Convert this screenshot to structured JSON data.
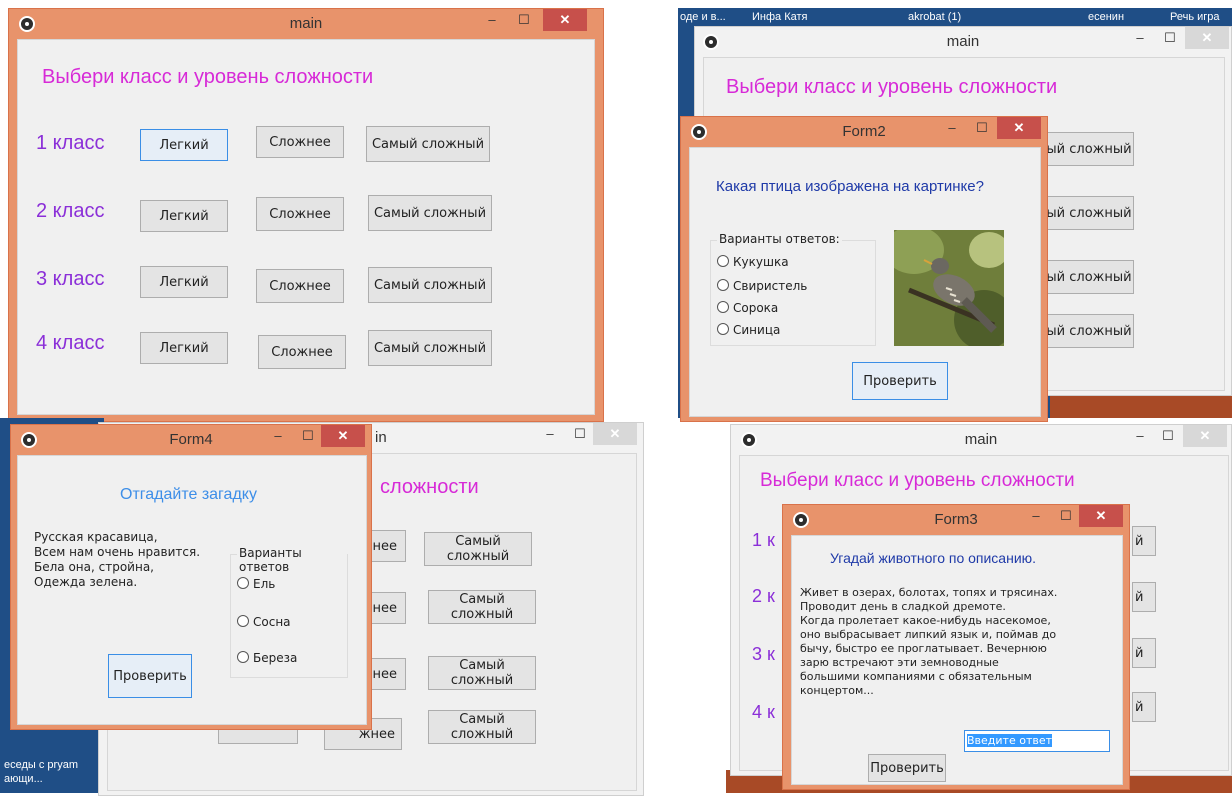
{
  "colors": {
    "frame_active": "#e8936b",
    "heading": "#d72ad7",
    "grade": "#8b2fd8",
    "question": "#1f3aa8",
    "riddle": "#3d8ee8"
  },
  "controls": {
    "minimize": "–",
    "maximize": "☐",
    "close": "✕"
  },
  "main": {
    "title": "main",
    "heading": "Выбери класс и уровень сложности",
    "rows": [
      {
        "grade": "1 класс",
        "easy": "Легкий",
        "harder": "Сложнее",
        "hardest": "Самый сложный"
      },
      {
        "grade": "2 класс",
        "easy": "Легкий",
        "harder": "Сложнее",
        "hardest": "Самый сложный"
      },
      {
        "grade": "3 класс",
        "easy": "Легкий",
        "harder": "Сложнее",
        "hardest": "Самый сложный"
      },
      {
        "grade": "4 класс",
        "easy": "Легкий",
        "harder": "Сложнее",
        "hardest": "Самый сложный"
      }
    ]
  },
  "desktop_tr": {
    "items": [
      "оде и в...",
      "Инфа Катя",
      "akrobat (1)",
      "есенин",
      "Речь игра"
    ]
  },
  "main_tr": {
    "title": "main",
    "heading": "Выбери класс и уровень сложности",
    "partial_buttons": [
      "ый сложный",
      "ый сложный",
      "ый сложный",
      "ый сложный"
    ]
  },
  "form2": {
    "title": "Form2",
    "question": "Какая птица изображена на картинке?",
    "group_label": "Варианты ответов:",
    "options": [
      "Кукушка",
      "Свиристель",
      "Сорока",
      "Синица"
    ],
    "check": "Проверить"
  },
  "main_bl": {
    "title_partial": "in",
    "heading_partial": "сложности",
    "partial_harder": [
      "нее",
      "нее",
      "нее",
      "жнее"
    ],
    "hardest": [
      "Самый сложный",
      "Самый сложный",
      "Самый сложный",
      "Самый сложный"
    ]
  },
  "desktop_bl": {
    "line1": "еседы с pryam",
    "line2": "ающи..."
  },
  "form4": {
    "title": "Form4",
    "heading": "Отгадайте загадку",
    "riddle": [
      "Русская красавица,",
      "Всем нам очень нравится.",
      "Бела она, стройна,",
      "Одежда зелена."
    ],
    "group_label": "Варианты ответов",
    "options": [
      "Ель",
      "Сосна",
      "Береза"
    ],
    "check": "Проверить"
  },
  "main_br": {
    "title": "main",
    "heading": "Выбери класс и уровень сложности",
    "grades_partial": [
      "1 к",
      "2 к",
      "3 к",
      "4 к"
    ],
    "partial_buttons": [
      "й",
      "й",
      "й",
      "й"
    ]
  },
  "form3": {
    "title": "Form3",
    "heading": "Угадай животного по описанию.",
    "description": [
      "Живет в озерах, болотах, топях и трясинах.",
      "Проводит день в сладкой дремоте.",
      "Когда пролетает какое-нибудь насекомое,",
      "оно выбрасывает липкий язык и, поймав до",
      "бычу, быстро ее проглатывает. Вечернюю",
      "зарю встречают эти земноводные",
      "большими компаниями с обязательным",
      "концертом..."
    ],
    "answer_value": "Введите ответ",
    "check": "Проверить"
  }
}
